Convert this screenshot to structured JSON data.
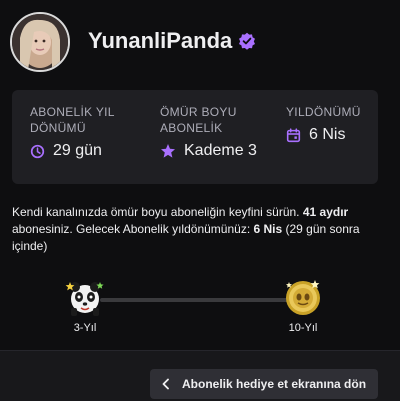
{
  "profile": {
    "username": "YunanliPanda",
    "verified_icon": "verified-badge-icon",
    "avatar": "user-avatar"
  },
  "stats": [
    {
      "label": "ABONELİK YIL DÖNÜMÜ",
      "value": "29 gün",
      "icon": "clock-icon"
    },
    {
      "label": "ÖMÜR BOYU ABONELİK",
      "value": "Kademe 3",
      "icon": "star-icon"
    },
    {
      "label": "YILDÖNÜMÜ",
      "value": "6 Nis",
      "icon": "calendar-icon"
    }
  ],
  "description": {
    "part1": "Kendi kanalınızda ömür boyu aboneliğin keyfini sürün. ",
    "months": "41 aydır",
    "part2": " abonesiniz. Gelecek Abonelik yıldönümünüz: ",
    "date": "6 Nis",
    "part3": " (29 gün sonra içinde)"
  },
  "milestones": [
    {
      "label": "3-Yıl",
      "icon": "panda-badge-icon"
    },
    {
      "label": "10-Yıl",
      "icon": "gold-coin-badge-icon"
    }
  ],
  "footer": {
    "back_label": "Abonelik hediye et ekranına dön",
    "back_icon": "chevron-left-icon"
  },
  "colors": {
    "background": "#0e0e10",
    "card": "#1f1f23",
    "accent": "#a970ff",
    "muted": "#adadb8"
  }
}
